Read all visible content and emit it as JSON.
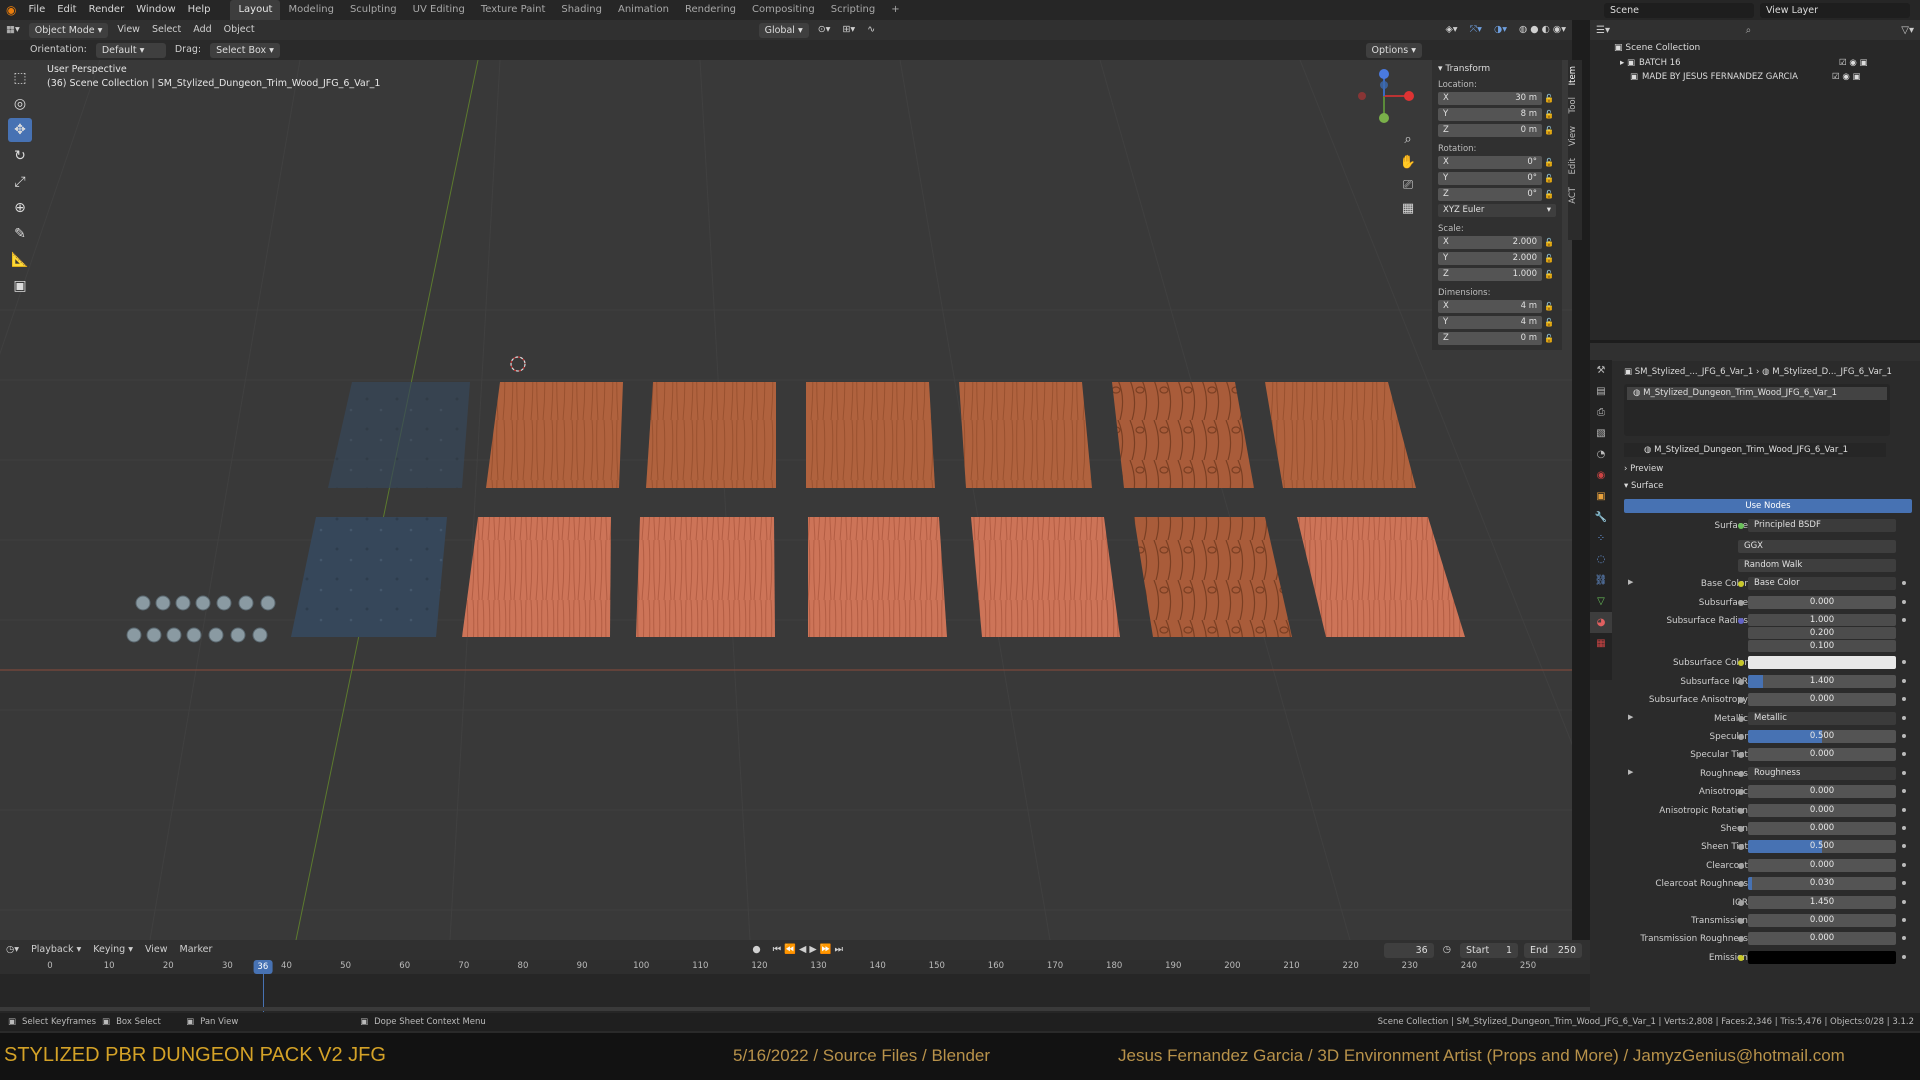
{
  "topbar": {
    "menus": [
      "File",
      "Edit",
      "Render",
      "Window",
      "Help"
    ],
    "workspaces": [
      "Layout",
      "Modeling",
      "Sculpting",
      "UV Editing",
      "Texture Paint",
      "Shading",
      "Animation",
      "Rendering",
      "Compositing",
      "Scripting"
    ],
    "active_workspace": "Layout",
    "add_tab": "+",
    "scene_label": "Scene",
    "view_layer_label": "View Layer"
  },
  "viewport_header": {
    "mode": "Object Mode",
    "menus": [
      "View",
      "Select",
      "Add",
      "Object"
    ],
    "orientation": "Global"
  },
  "tool_header": {
    "orientation_label": "Orientation:",
    "orientation_value": "Default",
    "drag_label": "Drag:",
    "drag_value": "Select Box",
    "options": "Options"
  },
  "viewport": {
    "view_name": "User Perspective",
    "collection_info": "(36) Scene Collection | SM_Stylized_Dungeon_Trim_Wood_JFG_6_Var_1"
  },
  "transform": {
    "title": "Transform",
    "location_label": "Location:",
    "location": [
      {
        "axis": "X",
        "value": "30 m"
      },
      {
        "axis": "Y",
        "value": "8 m"
      },
      {
        "axis": "Z",
        "value": "0 m"
      }
    ],
    "rotation_label": "Rotation:",
    "rotation": [
      {
        "axis": "X",
        "value": "0°"
      },
      {
        "axis": "Y",
        "value": "0°"
      },
      {
        "axis": "Z",
        "value": "0°"
      }
    ],
    "rotation_mode": "XYZ Euler",
    "scale_label": "Scale:",
    "scale": [
      {
        "axis": "X",
        "value": "2.000"
      },
      {
        "axis": "Y",
        "value": "2.000"
      },
      {
        "axis": "Z",
        "value": "1.000"
      }
    ],
    "dimensions_label": "Dimensions:",
    "dimensions": [
      {
        "axis": "X",
        "value": "4 m"
      },
      {
        "axis": "Y",
        "value": "4 m"
      },
      {
        "axis": "Z",
        "value": "0 m"
      }
    ]
  },
  "side_tabs": [
    "Item",
    "Tool",
    "View",
    "Edit",
    "ACT"
  ],
  "outliner": {
    "root": "Scene Collection",
    "items": [
      "BATCH 16",
      "MADE BY JESUS FERNANDEZ GARCIA"
    ]
  },
  "properties": {
    "breadcrumb_object": "SM_Stylized_..._JFG_6_Var_1",
    "breadcrumb_material": "M_Stylized_D..._JFG_6_Var_1",
    "slot_material": "M_Stylized_Dungeon_Trim_Wood_JFG_6_Var_1",
    "material_name": "M_Stylized_Dungeon_Trim_Wood_JFG_6_Var_1",
    "preview_label": "Preview",
    "surface_panel_label": "Surface",
    "use_nodes": "Use Nodes",
    "surface_label": "Surface",
    "surface_value": "Principled BSDF",
    "distribution": "GGX",
    "subsurface_method": "Random Walk",
    "inputs": [
      {
        "label": "Base Color",
        "kind": "link",
        "value": "Base Color",
        "dot": "#c7c729"
      },
      {
        "label": "Subsurface",
        "kind": "num",
        "value": "0.000",
        "dot": "#a1a1a1",
        "fill": 0
      },
      {
        "label": "Subsurface Radius",
        "kind": "vec",
        "value": [
          "1.000",
          "0.200",
          "0.100"
        ],
        "dot": "#6363c7"
      },
      {
        "label": "Subsurface Color",
        "kind": "color",
        "color": "#e8e8e8",
        "dot": "#c7c729"
      },
      {
        "label": "Subsurface IOR",
        "kind": "num",
        "value": "1.400",
        "dot": "#a1a1a1",
        "fill": 0.1
      },
      {
        "label": "Subsurface Anisotropy",
        "kind": "num",
        "value": "0.000",
        "dot": "#a1a1a1",
        "fill": 0
      },
      {
        "label": "Metallic",
        "kind": "link",
        "value": "Metallic",
        "dot": "#a1a1a1"
      },
      {
        "label": "Specular",
        "kind": "num",
        "value": "0.500",
        "dot": "#a1a1a1",
        "fill": 0.5
      },
      {
        "label": "Specular Tint",
        "kind": "num",
        "value": "0.000",
        "dot": "#a1a1a1",
        "fill": 0
      },
      {
        "label": "Roughness",
        "kind": "link",
        "value": "Roughness",
        "dot": "#a1a1a1"
      },
      {
        "label": "Anisotropic",
        "kind": "num",
        "value": "0.000",
        "dot": "#a1a1a1",
        "fill": 0
      },
      {
        "label": "Anisotropic Rotation",
        "kind": "num",
        "value": "0.000",
        "dot": "#a1a1a1",
        "fill": 0
      },
      {
        "label": "Sheen",
        "kind": "num",
        "value": "0.000",
        "dot": "#a1a1a1",
        "fill": 0
      },
      {
        "label": "Sheen Tint",
        "kind": "num",
        "value": "0.500",
        "dot": "#a1a1a1",
        "fill": 0.5
      },
      {
        "label": "Clearcoat",
        "kind": "num",
        "value": "0.000",
        "dot": "#a1a1a1",
        "fill": 0
      },
      {
        "label": "Clearcoat Roughness",
        "kind": "num",
        "value": "0.030",
        "dot": "#a1a1a1",
        "fill": 0.03
      },
      {
        "label": "IOR",
        "kind": "num",
        "value": "1.450",
        "dot": "#a1a1a1",
        "fill": 0
      },
      {
        "label": "Transmission",
        "kind": "num",
        "value": "0.000",
        "dot": "#a1a1a1",
        "fill": 0
      },
      {
        "label": "Transmission Roughness",
        "kind": "num",
        "value": "0.000",
        "dot": "#a1a1a1",
        "fill": 0
      },
      {
        "label": "Emission",
        "kind": "color",
        "color": "#000000",
        "dot": "#c7c729"
      }
    ]
  },
  "timeline_header": {
    "menus": [
      "Playback",
      "Keying",
      "View",
      "Marker"
    ],
    "current_frame": "36",
    "start_label": "Start",
    "start": "1",
    "end_label": "End",
    "end": "250"
  },
  "timeline": {
    "ticks": [
      "0",
      "10",
      "20",
      "30",
      "40",
      "50",
      "60",
      "70",
      "80",
      "90",
      "100",
      "110",
      "120",
      "130",
      "140",
      "150",
      "160",
      "170",
      "180",
      "190",
      "200",
      "210",
      "220",
      "230",
      "240",
      "250"
    ],
    "playhead": "36"
  },
  "statusbar": {
    "left": [
      "Select Keyframes",
      "Box Select",
      "Pan View",
      "Dope Sheet Context Menu"
    ],
    "right": "Scene Collection | SM_Stylized_Dungeon_Trim_Wood_JFG_6_Var_1 | Verts:2,808 | Faces:2,346 | Tris:5,476 | Objects:0/28 | 3.1.2"
  },
  "banner": {
    "title": "STYLIZED PBR DUNGEON PACK V2 JFG",
    "middle": "5/16/2022 / Source Files / Blender",
    "right": "Jesus Fernandez Garcia / 3D Environment Artist (Props and More) / JamyzGenius@hotmail.com"
  },
  "colors": {
    "accent": "#4772b3",
    "wood_top": "#b0623e",
    "wood_bottom": "#cd7458",
    "stone": "#3a4a5a",
    "banner_title": "#d4a227",
    "banner_text": "#b8924a"
  },
  "icons": [
    "blender-icon",
    "select-icon",
    "cursor-icon",
    "move-icon",
    "rotate-icon",
    "scale-icon",
    "transform-icon",
    "annotate-icon",
    "measure-icon",
    "add-cube-icon",
    "zoom-icon",
    "hand-icon",
    "camera-icon",
    "grid-icon",
    "lock-icon",
    "eye-icon",
    "search-icon",
    "filter-icon",
    "play-icon"
  ]
}
